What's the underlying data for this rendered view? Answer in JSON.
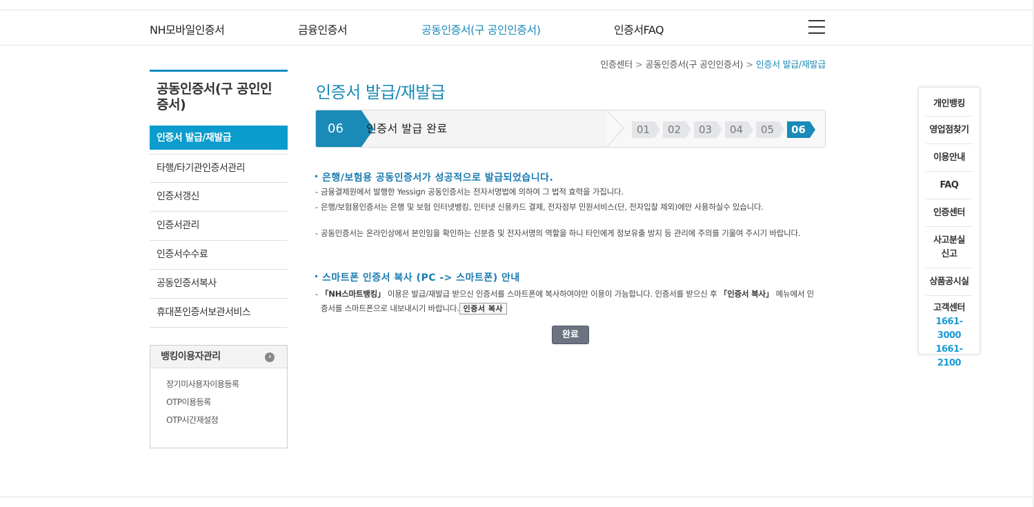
{
  "gnb": {
    "items": [
      {
        "label": "NH모바일인증서",
        "active": false
      },
      {
        "label": "금융인증서",
        "active": false
      },
      {
        "label": "공동인증서(구 공인인증서)",
        "active": true
      },
      {
        "label": "인증서FAQ",
        "active": false
      }
    ],
    "menu_icon": "hamburger-icon"
  },
  "breadcrumb": {
    "items": [
      "인증센터",
      "공동인증서(구 공인인증서)"
    ],
    "current": "인증서 발급/재발급",
    "separator": ">"
  },
  "lnb": {
    "title": "공동인증서(구 공인인증서)",
    "items": [
      {
        "label": "인증서 발급/재발급",
        "active": true
      },
      {
        "label": "타행/타기관인증서관리"
      },
      {
        "label": "인증서갱신"
      },
      {
        "label": "인증서관리"
      },
      {
        "label": "인증서수수료"
      },
      {
        "label": "공동인증서복사"
      },
      {
        "label": "휴대폰인증서보관서비스"
      }
    ]
  },
  "subbox": {
    "title": "뱅킹이용자관리",
    "items": [
      "장기미사용자이용등록",
      "OTP이용등록",
      "OTP시간재설정"
    ]
  },
  "content": {
    "page_title": "인증서 발급/재발급",
    "step": {
      "current_num": "06",
      "current_label": "인증서 발급 완료",
      "steps": [
        "01",
        "02",
        "03",
        "04",
        "05",
        "06"
      ],
      "active_step": "06"
    },
    "section1": {
      "title": "은행/보험용 공동인증서가 성공적으로 발급되었습니다.",
      "lines": [
        "금융결제원에서 발행한 Yessign 공동인증서는 전자서명법에 의하여 그 법적 효력을 가집니다.",
        "은행/보험용인증서는 은행 및 보험 인터넷뱅킹, 인터넷 신용카드 결제, 전자정부 민원서비스(단, 전자입찰 제외)에만 사용하실수 있습니다.",
        "공동인증서는 온라인상에서 본인임을 확인하는 신분증 및 전자서명의 역할을 하니 타인에게 정보유출 방지 등 관리에 주의를 기울여 주시기 바랍니다."
      ]
    },
    "section2": {
      "title": "스마트폰 인증서 복사 (PC -> 스마트폰) 안내",
      "line_part1": "「NH스마트뱅킹」",
      "line_part2": " 이용은 발급/재발급 받으신 인증서를 스마트폰에 복사하여야만 이용이 가능합니다. 인증서를 받으신 후 ",
      "line_part3": "「인증서 복사」",
      "line_part4": " 메뉴에서 인증서를 스마트폰으로 내보내시기 바랍니다.",
      "copy_button": "인증서 복사"
    },
    "done_button": "완료"
  },
  "quick": {
    "items": [
      "개인뱅킹",
      "영업점찾기",
      "이용안내",
      "FAQ",
      "인증센터"
    ],
    "two_line": [
      "사고분실",
      "신고"
    ],
    "item_after": "상품공시실",
    "customer_center": "고객센터",
    "tels": [
      "1661-3000",
      "1661-2100"
    ]
  }
}
